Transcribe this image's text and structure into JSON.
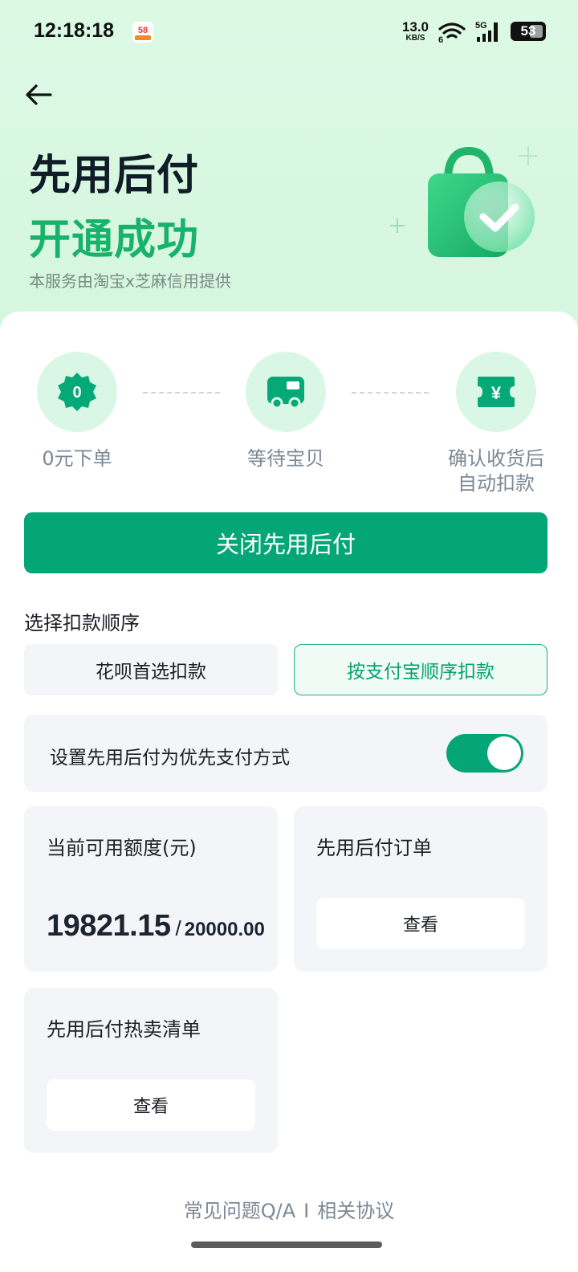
{
  "status_bar": {
    "time": "12:18:18",
    "app_badge": "58",
    "net_speed_value": "13.0",
    "net_speed_unit": "KB/S",
    "wifi_label": "6",
    "signal_label": "5G",
    "battery": "53"
  },
  "header": {
    "title_line1": "先用后付",
    "title_line2": "开通成功",
    "subtitle": "本服务由淘宝x芝麻信用提供"
  },
  "steps": [
    {
      "badge": "0",
      "label": "0元下单",
      "icon": "badge-zero-icon"
    },
    {
      "label": "等待宝贝",
      "icon": "truck-icon"
    },
    {
      "label_line1": "确认收货后",
      "label_line2": "自动扣款",
      "icon": "ticket-yen-icon",
      "badge": "¥"
    }
  ],
  "actions": {
    "close_label": "关闭先用后付"
  },
  "deduction": {
    "title": "选择扣款顺序",
    "options": [
      "花呗首选扣款",
      "按支付宝顺序扣款"
    ],
    "selected_index": 1
  },
  "priority": {
    "label": "设置先用后付为优先支付方式",
    "enabled": true
  },
  "credit": {
    "title": "当前可用额度(元)",
    "available": "19821.15",
    "separator": "/",
    "total": "20000.00"
  },
  "orders": {
    "title": "先用后付订单",
    "view_label": "查看"
  },
  "hot_list": {
    "title": "先用后付热卖清单",
    "view_label": "查看"
  },
  "footer": {
    "faq": "常见问题Q/A",
    "divider": "I",
    "agreement": "相关协议"
  },
  "colors": {
    "brand_green": "#04a677",
    "title_green": "#19b26b",
    "hero_bg": "#dcf9e4",
    "tile_bg": "#f3f5f8"
  }
}
